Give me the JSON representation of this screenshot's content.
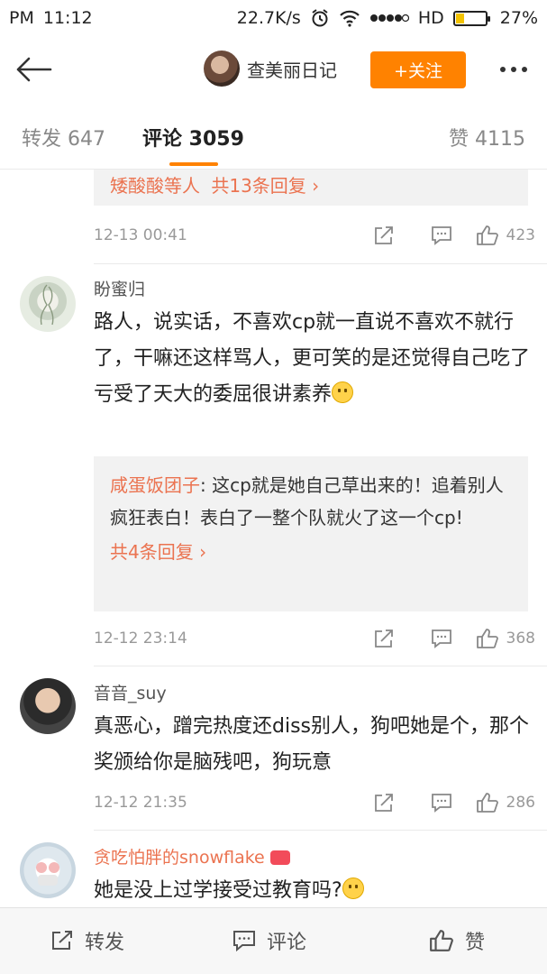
{
  "status_bar": {
    "ampm": "PM",
    "time": "11:12",
    "network_speed": "22.7K/s",
    "signal_label": "HD",
    "battery": "27%",
    "battery_level": 0.27
  },
  "header": {
    "account_name": "查美丽日记",
    "follow_label": "+关注"
  },
  "tabs": [
    {
      "label": "转发 647"
    },
    {
      "label": "评论 3059",
      "active": true
    },
    {
      "label": "赞 4115"
    }
  ],
  "comments": [
    {
      "partial": true,
      "reply_box": {
        "link_name": "矮酸酸等人",
        "link_text": "共13条回复"
      },
      "time": "12-13 00:41",
      "likes": "423"
    },
    {
      "user": "盼蜜归",
      "text": "路人，说实话，不喜欢cp就一直说不喜欢不就行了，干嘛还这样骂人，更可笑的是还觉得自己吃了亏受了天大的委屈很讲素养",
      "reply_box": {
        "reply_user": "咸蛋饭团子",
        "reply_text": ": 这cp就是她自己草出来的！追着别人疯狂表白！表白了一整个队就火了这一个cp!",
        "link_text": "共4条回复"
      },
      "time": "12-12 23:14",
      "likes": "368"
    },
    {
      "user": "音音_suy",
      "text": "真恶心，蹭完热度还diss别人，狗吧她是个，那个奖颁给你是脑残吧，狗玩意",
      "time": "12-12 21:35",
      "likes": "286"
    },
    {
      "user": "贪吃怕胖的snowflake",
      "text": "她是没上过学接受过教育吗?"
    }
  ],
  "bottom_bar": {
    "repost": "转发",
    "comment": "评论",
    "like": "赞"
  },
  "colors": {
    "accent": "#ff8200",
    "link": "#eb7350"
  }
}
